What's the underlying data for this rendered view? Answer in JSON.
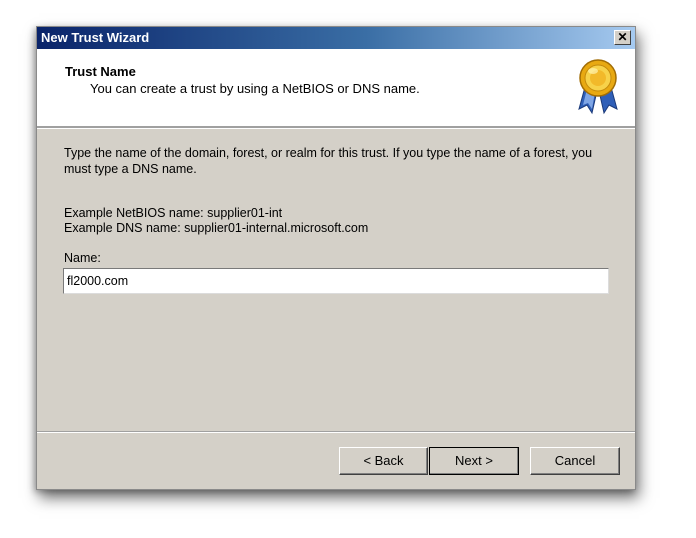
{
  "window": {
    "title": "New Trust Wizard",
    "close_glyph": "✕"
  },
  "header": {
    "title": "Trust Name",
    "subtitle": "You can create a trust by using a NetBIOS or DNS name.",
    "icon": "award-medal-icon"
  },
  "content": {
    "instructions": "Type the name of the domain, forest, or realm for this trust. If you type the name of a forest, you must type a DNS name.",
    "example_netbios": "Example NetBIOS name: supplier01-int",
    "example_dns": "Example DNS name: supplier01-internal.microsoft.com",
    "name_label": "Name:",
    "name_value": "fl2000.com"
  },
  "buttons": {
    "back": "< Back",
    "next": "Next >",
    "cancel": "Cancel"
  },
  "colors": {
    "title_bar_start": "#0a246a",
    "title_bar_end": "#a6caf0",
    "dialog_face": "#d4d0c8"
  }
}
